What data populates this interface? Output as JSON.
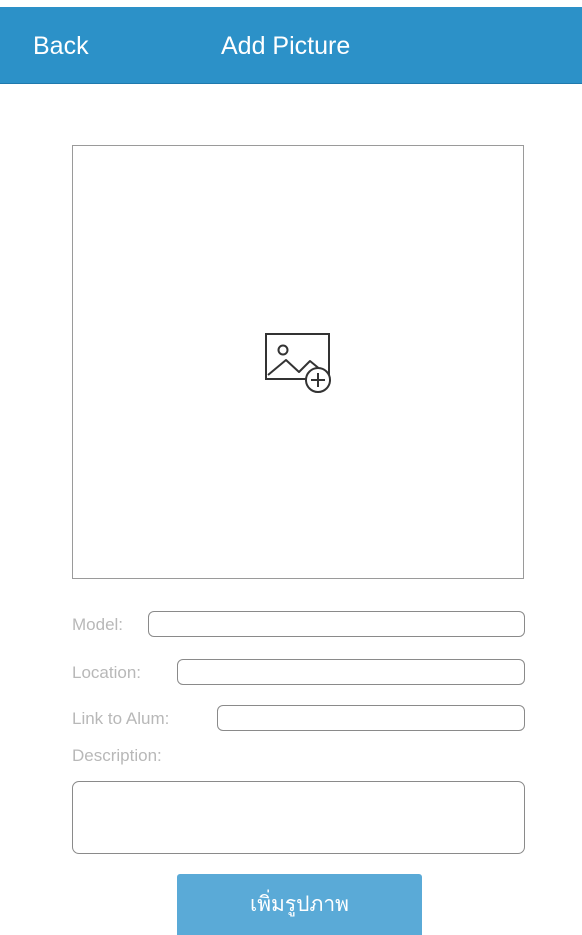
{
  "navbar": {
    "back_label": "Back",
    "title": "Add Picture",
    "background_color": "#2c91c8"
  },
  "image_picker": {
    "icon": "add-image-icon"
  },
  "form": {
    "model_label": "Model:",
    "model_value": "",
    "location_label": "Location:",
    "location_value": "",
    "link_label": "Link to Alum:",
    "link_value": "",
    "description_label": "Description:",
    "description_value": ""
  },
  "submit": {
    "label": "เพิ่มรูปภาพ",
    "color": "#5aaad7"
  }
}
